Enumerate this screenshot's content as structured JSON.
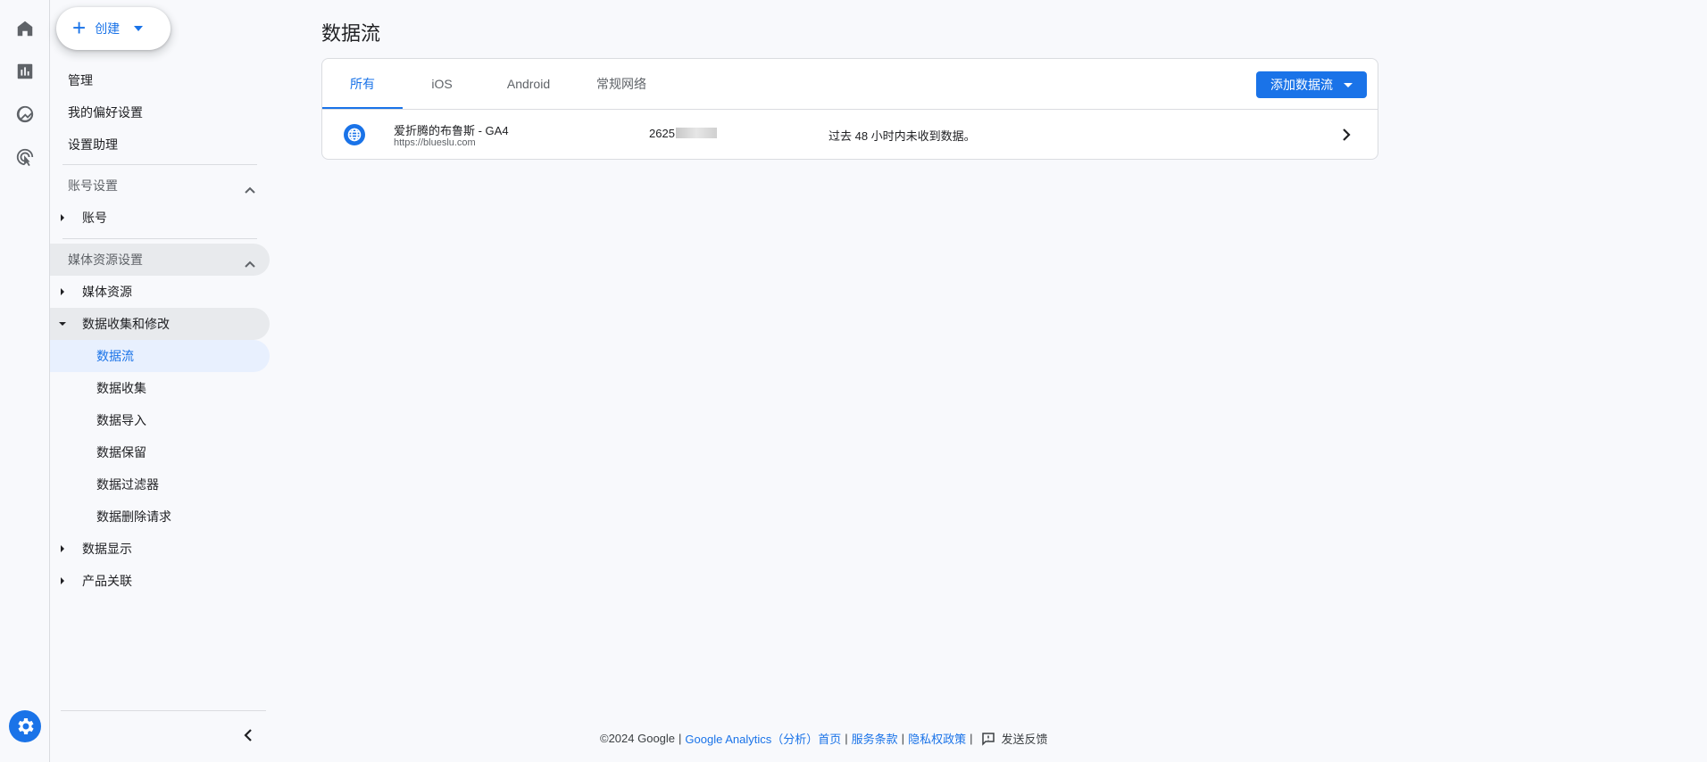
{
  "create": {
    "label": "创建"
  },
  "nav": {
    "top": [
      "管理",
      "我的偏好设置",
      "设置助理"
    ],
    "account_settings": {
      "label": "账号设置",
      "items": [
        "账号"
      ]
    },
    "property_settings": {
      "label": "媒体资源设置",
      "property": "媒体资源",
      "data_collection": {
        "label": "数据收集和修改",
        "children": [
          "数据流",
          "数据收集",
          "数据导入",
          "数据保留",
          "数据过滤器",
          "数据删除请求"
        ]
      },
      "data_display": "数据显示",
      "product_links": "产品关联"
    }
  },
  "page": {
    "title": "数据流"
  },
  "tabs": [
    "所有",
    "iOS",
    "Android",
    "常规网络"
  ],
  "add_stream": {
    "label": "添加数据流"
  },
  "stream": {
    "name": "爱折腾的布鲁斯 - GA4",
    "url": "https://blueslu.com",
    "id": "2625",
    "status": "过去 48 小时内未收到数据。"
  },
  "footer": {
    "copyright": "©2024 Google",
    "home": "Google Analytics（分析）首页",
    "terms": "服务条款",
    "privacy": "隐私权政策",
    "feedback": "发送反馈"
  },
  "colors": {
    "accent": "#1a73e8",
    "active_bg": "#e8f0fe",
    "bg": "#f8f9fc"
  }
}
